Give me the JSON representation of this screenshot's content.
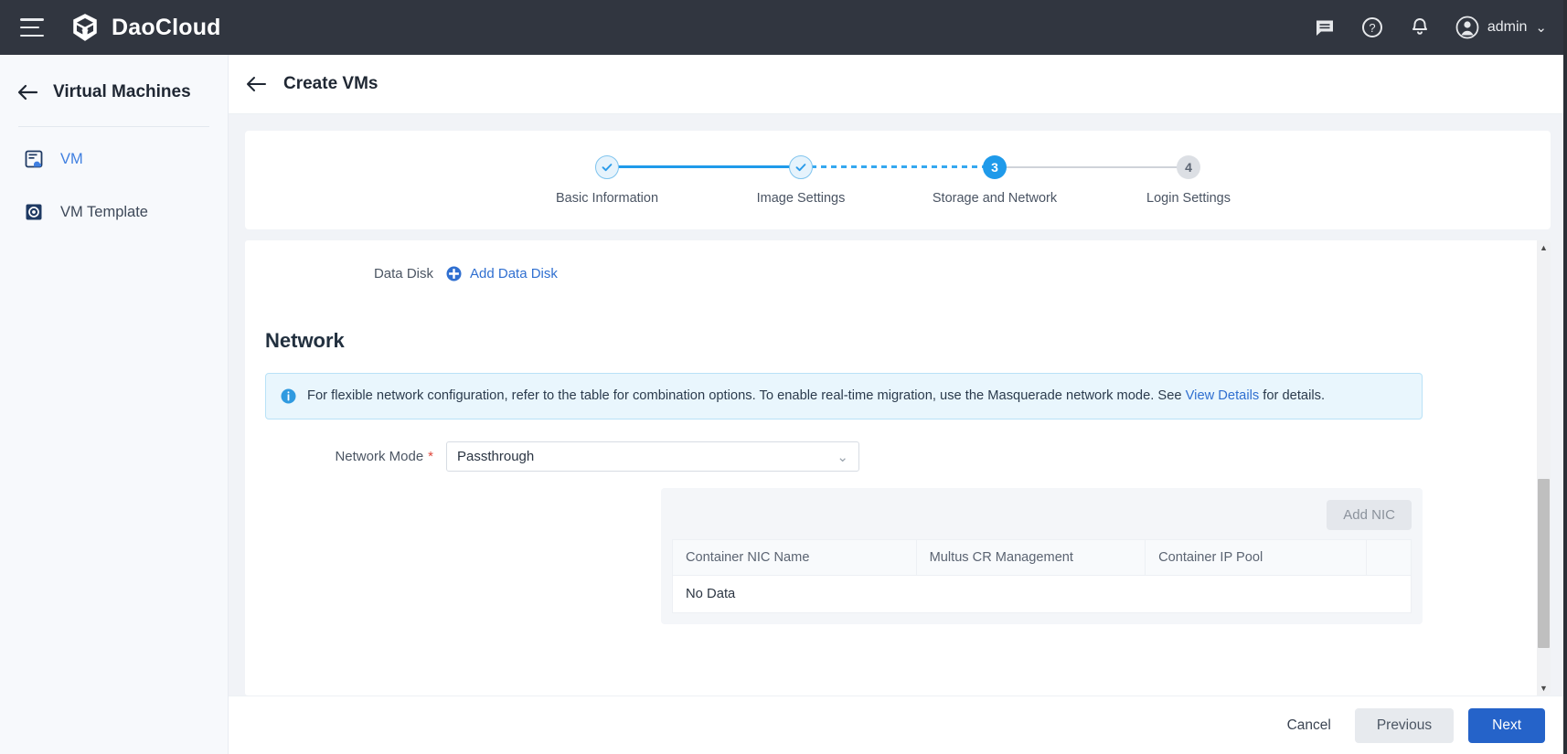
{
  "topbar": {
    "brand": "DaoCloud",
    "menu_icon": "hamburger-icon",
    "icons": [
      "chat-icon",
      "help-icon",
      "bell-icon"
    ],
    "user": "admin",
    "chevron": "⌄"
  },
  "sidebar": {
    "back_icon": "arrow-left-icon",
    "title": "Virtual Machines",
    "items": [
      {
        "label": "VM",
        "icon": "vm-icon",
        "active": true
      },
      {
        "label": "VM Template",
        "icon": "vm-template-icon",
        "active": false
      }
    ]
  },
  "page": {
    "back_icon": "arrow-left-icon",
    "title": "Create VMs"
  },
  "stepper": {
    "steps": [
      {
        "label": "Basic Information",
        "marker": "✓",
        "state": "done"
      },
      {
        "label": "Image Settings",
        "marker": "✓",
        "state": "done"
      },
      {
        "label": "Storage and Network",
        "marker": "3",
        "state": "current"
      },
      {
        "label": "Login Settings",
        "marker": "4",
        "state": "todo"
      }
    ]
  },
  "form": {
    "data_disk": {
      "label": "Data Disk",
      "add_icon": "add-circle-icon",
      "add_label": "Add Data Disk"
    },
    "network_section_title": "Network",
    "info_banner": {
      "icon": "info-icon",
      "text_before": "For flexible network configuration, refer to the table for combination options. To enable real-time migration, use the Masquerade network mode. See ",
      "link": "View Details",
      "text_after": " for details."
    },
    "network_mode": {
      "label": "Network Mode",
      "required_mark": "*",
      "value": "Passthrough",
      "chevron": "⌄"
    },
    "nic_panel": {
      "add_button": "Add NIC",
      "columns": [
        "Container NIC Name",
        "Multus CR Management",
        "Container IP Pool",
        ""
      ],
      "empty_text": "No Data",
      "rows": []
    }
  },
  "footer": {
    "cancel": "Cancel",
    "previous": "Previous",
    "next": "Next"
  },
  "colors": {
    "topbar_bg": "#313640",
    "accent_blue": "#2563c9",
    "step_blue": "#1f9aea",
    "link_blue": "#2f6fd0",
    "required_red": "#e0483c",
    "banner_bg": "#e9f6fd"
  }
}
